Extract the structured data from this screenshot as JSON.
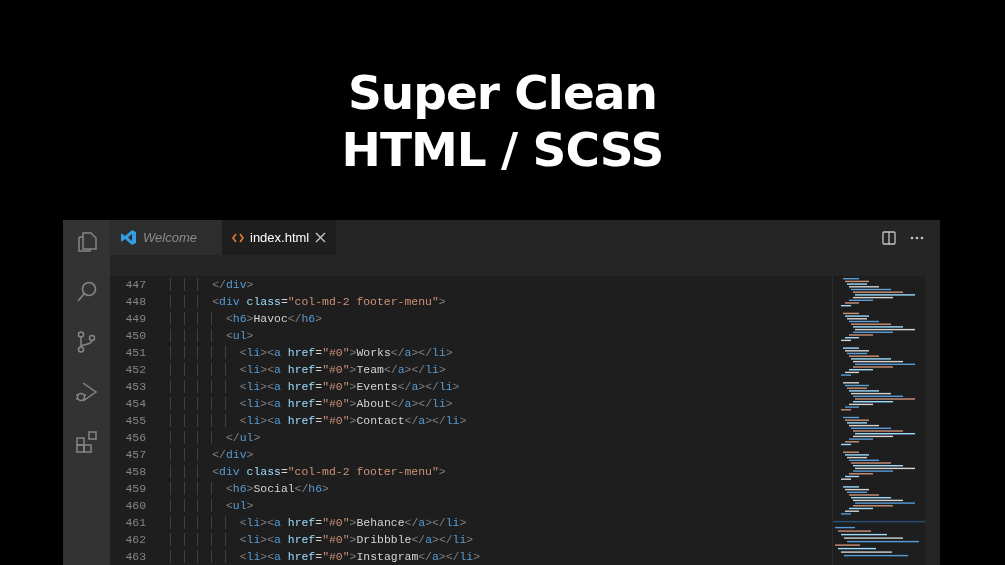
{
  "headline": [
    "Super Clean",
    "HTML / SCSS"
  ],
  "tabs": [
    {
      "label": "Welcome",
      "kind": "welcome",
      "preview": true,
      "selected": false
    },
    {
      "label": "index.html",
      "kind": "html",
      "preview": false,
      "selected": true
    }
  ],
  "editor": {
    "lines": [
      {
        "number": "447",
        "code": "      </div>"
      },
      {
        "number": "448",
        "code": "      <div class=\"col-md-2 footer-menu\">"
      },
      {
        "number": "449",
        "code": "        <h6>Havoc</h6>"
      },
      {
        "number": "450",
        "code": "        <ul>"
      },
      {
        "number": "451",
        "code": "          <li><a href=\"#0\">Works</a></li>"
      },
      {
        "number": "452",
        "code": "          <li><a href=\"#0\">Team</a></li>"
      },
      {
        "number": "453",
        "code": "          <li><a href=\"#0\">Events</a></li>"
      },
      {
        "number": "454",
        "code": "          <li><a href=\"#0\">About</a></li>"
      },
      {
        "number": "455",
        "code": "          <li><a href=\"#0\">Contact</a></li>"
      },
      {
        "number": "456",
        "code": "        </ul>"
      },
      {
        "number": "457",
        "code": "      </div>"
      },
      {
        "number": "458",
        "code": "      <div class=\"col-md-2 footer-menu\">"
      },
      {
        "number": "459",
        "code": "        <h6>Social</h6>"
      },
      {
        "number": "460",
        "code": "        <ul>"
      },
      {
        "number": "461",
        "code": "          <li><a href=\"#0\">Behance</a></li>"
      },
      {
        "number": "462",
        "code": "          <li><a href=\"#0\">Dribbble</a></li>"
      },
      {
        "number": "463",
        "code": "          <li><a href=\"#0\">Instagram</a></li>"
      }
    ]
  }
}
